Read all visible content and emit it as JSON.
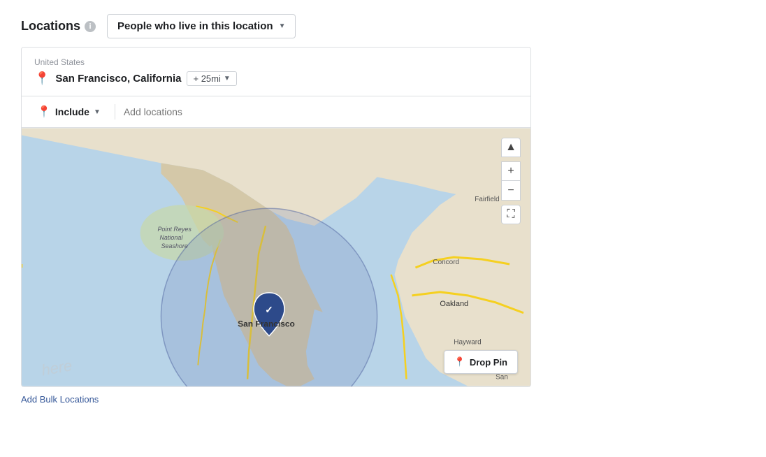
{
  "header": {
    "locations_label": "Locations",
    "info_icon": "i",
    "dropdown_label": "People who live in this location",
    "dropdown_arrow": "▼"
  },
  "location_panel": {
    "country": "United States",
    "city": "San Francisco, California",
    "radius": "+ 25mi",
    "radius_arrow": "▼"
  },
  "include_bar": {
    "include_label": "Include",
    "include_arrow": "▼",
    "add_locations_placeholder": "Add locations"
  },
  "map": {
    "drop_pin_label": "Drop Pin",
    "drop_pin_icon": "📍",
    "zoom_in": "+",
    "zoom_out": "−",
    "fullscreen": "⛶",
    "pan_up": "▲",
    "cities": [
      "San Francisco",
      "Oakland",
      "Concord",
      "Hayward",
      "Fairfield",
      "San"
    ],
    "regions": [
      "Point Reyes National Seashore"
    ]
  },
  "footer": {
    "add_bulk_label": "Add Bulk Locations"
  }
}
